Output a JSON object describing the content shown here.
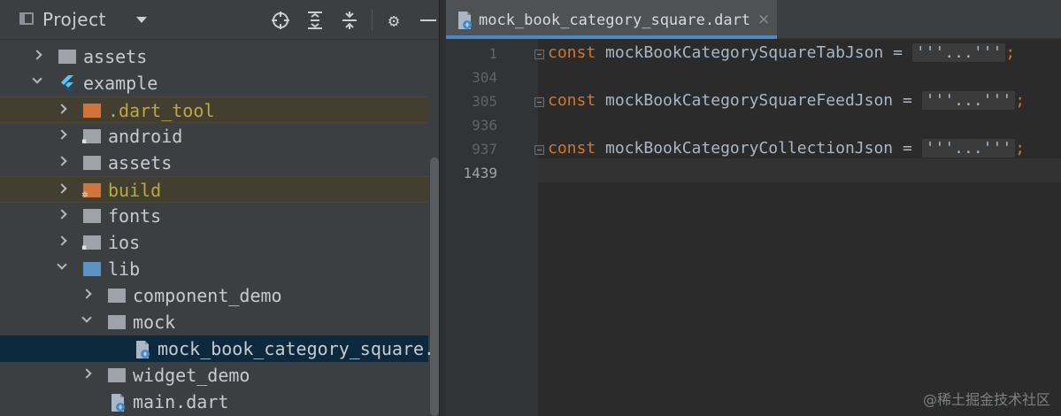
{
  "project_panel": {
    "title": "Project",
    "tree": [
      {
        "label": "assets",
        "indent": 0,
        "expanded": false,
        "type": "folder-grey"
      },
      {
        "label": "example",
        "indent": 0,
        "expanded": true,
        "type": "flutter"
      },
      {
        "label": ".dart_tool",
        "indent": 1,
        "expanded": false,
        "type": "folder-orange",
        "excluded": true
      },
      {
        "label": "android",
        "indent": 1,
        "expanded": false,
        "type": "folder-grey-android"
      },
      {
        "label": "assets",
        "indent": 1,
        "expanded": false,
        "type": "folder-grey"
      },
      {
        "label": "build",
        "indent": 1,
        "expanded": false,
        "type": "folder-orange-build",
        "excluded": true
      },
      {
        "label": "fonts",
        "indent": 1,
        "expanded": false,
        "type": "folder-grey"
      },
      {
        "label": "ios",
        "indent": 1,
        "expanded": false,
        "type": "folder-grey-ios"
      },
      {
        "label": "lib",
        "indent": 1,
        "expanded": true,
        "type": "folder-blue"
      },
      {
        "label": "component_demo",
        "indent": 2,
        "expanded": false,
        "type": "folder-grey"
      },
      {
        "label": "mock",
        "indent": 2,
        "expanded": true,
        "type": "folder-grey"
      },
      {
        "label": "mock_book_category_square.",
        "indent": 3,
        "type": "dart-file",
        "selected": true
      },
      {
        "label": "widget_demo",
        "indent": 2,
        "expanded": false,
        "type": "folder-grey"
      },
      {
        "label": "main.dart",
        "indent": 2,
        "type": "dart-file"
      }
    ]
  },
  "editor": {
    "tab_label": "mock_book_category_square.dart",
    "tab_close": "×",
    "lines": [
      {
        "number": "1",
        "code": [
          {
            "t": "const",
            "k": "kw"
          },
          {
            "t": " mockBookCategorySquareTabJson = "
          },
          {
            "t": "'''...'''",
            "k": "folded"
          },
          {
            "t": ";",
            "k": "semi"
          }
        ]
      },
      {
        "number": "304",
        "code": []
      },
      {
        "number": "305",
        "code": [
          {
            "t": "const",
            "k": "kw"
          },
          {
            "t": " mockBookCategorySquareFeedJson = "
          },
          {
            "t": "'''...'''",
            "k": "folded"
          },
          {
            "t": ";",
            "k": "semi"
          }
        ]
      },
      {
        "number": "936",
        "code": []
      },
      {
        "number": "937",
        "code": [
          {
            "t": "const",
            "k": "kw"
          },
          {
            "t": " mockBookCategoryCollectionJson = "
          },
          {
            "t": "'''...'''",
            "k": "folded"
          },
          {
            "t": ";",
            "k": "semi"
          }
        ]
      },
      {
        "number": "1439",
        "code": [],
        "current": true
      }
    ]
  },
  "watermark": "@稀土掘金技术社区",
  "colors": {
    "keyword": "#cc7832",
    "selection": "#0d293e",
    "excluded_bg": "#423f31",
    "excluded_text": "#bfa73f",
    "tab_underline": "#4a88c7"
  }
}
